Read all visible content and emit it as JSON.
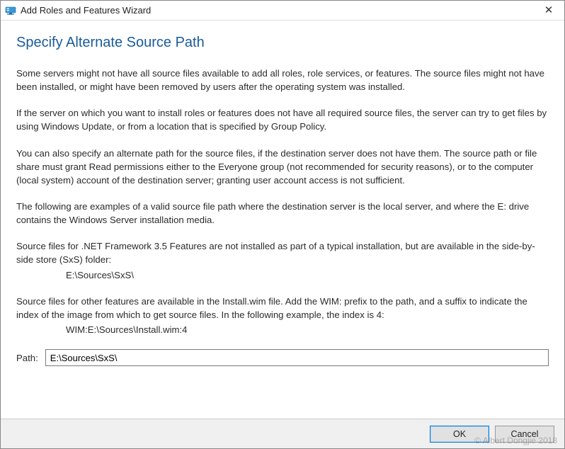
{
  "title_bar": {
    "title": "Add Roles and Features Wizard",
    "close_tooltip": "Close"
  },
  "heading": "Specify Alternate Source Path",
  "paragraphs": {
    "p1": "Some servers might not have all source files available to add all roles, role services, or features. The source files might not have been installed, or might have been removed by users after the operating system was installed.",
    "p2": "If the server on which you want to install roles or features does not have all required source files, the server can try to get files by using Windows Update, or from a location that is specified by Group Policy.",
    "p3": "You can also specify an alternate path for the source files, if the destination server does not have them. The source path or file share must grant Read permissions either to the Everyone group (not recommended for security reasons), or to the computer (local system) account of the destination server; granting user account access is not sufficient.",
    "p4": "The following are examples of a valid source file path where the destination server is the local server, and where the E: drive contains the Windows Server installation media.",
    "p5a": "Source files for .NET Framework 3.5 Features are not installed as part of a typical installation, but are available in the side-by-side store (SxS) folder:",
    "p5b": "E:\\Sources\\SxS\\",
    "p6a": "Source files for other features are available in the Install.wim file. Add the WIM: prefix to the path, and a suffix to indicate the index of the image from which to get source files. In the following example, the index is 4:",
    "p6b": "WIM:E:\\Sources\\Install.wim:4"
  },
  "path_field": {
    "label": "Path:",
    "value": "E:\\Sources\\SxS\\"
  },
  "buttons": {
    "ok": "OK",
    "cancel": "Cancel"
  },
  "watermark": "© Albert Dongjie 2018"
}
